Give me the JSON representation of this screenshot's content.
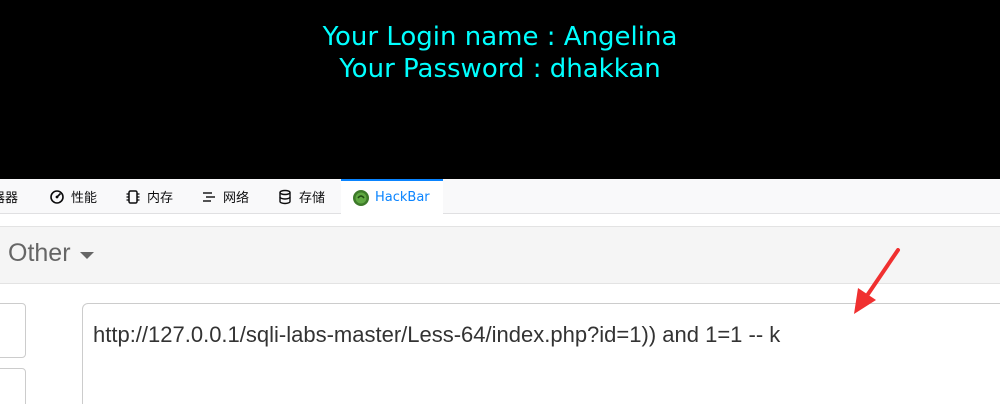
{
  "result": {
    "login_line": "Your Login name : Angelina",
    "password_line": "Your Password : dhakkan",
    "text_color": "#00ffff"
  },
  "devtools_tabs": [
    {
      "label": "调试器",
      "visible_label": "器器",
      "icon": "debugger-icon"
    },
    {
      "label": "性能",
      "icon": "performance-icon"
    },
    {
      "label": "内存",
      "icon": "memory-icon"
    },
    {
      "label": "网络",
      "icon": "network-icon"
    },
    {
      "label": "存储",
      "icon": "storage-icon"
    },
    {
      "label": "HackBar",
      "icon": "hackbar-icon",
      "active": true
    }
  ],
  "hackbar": {
    "menu_other": "Other",
    "url_value": "http://127.0.0.1/sqli-labs-master/Less-64/index.php?id=1)) and 1=1 -- k"
  },
  "annotation": {
    "arrow_color": "#f03030"
  }
}
